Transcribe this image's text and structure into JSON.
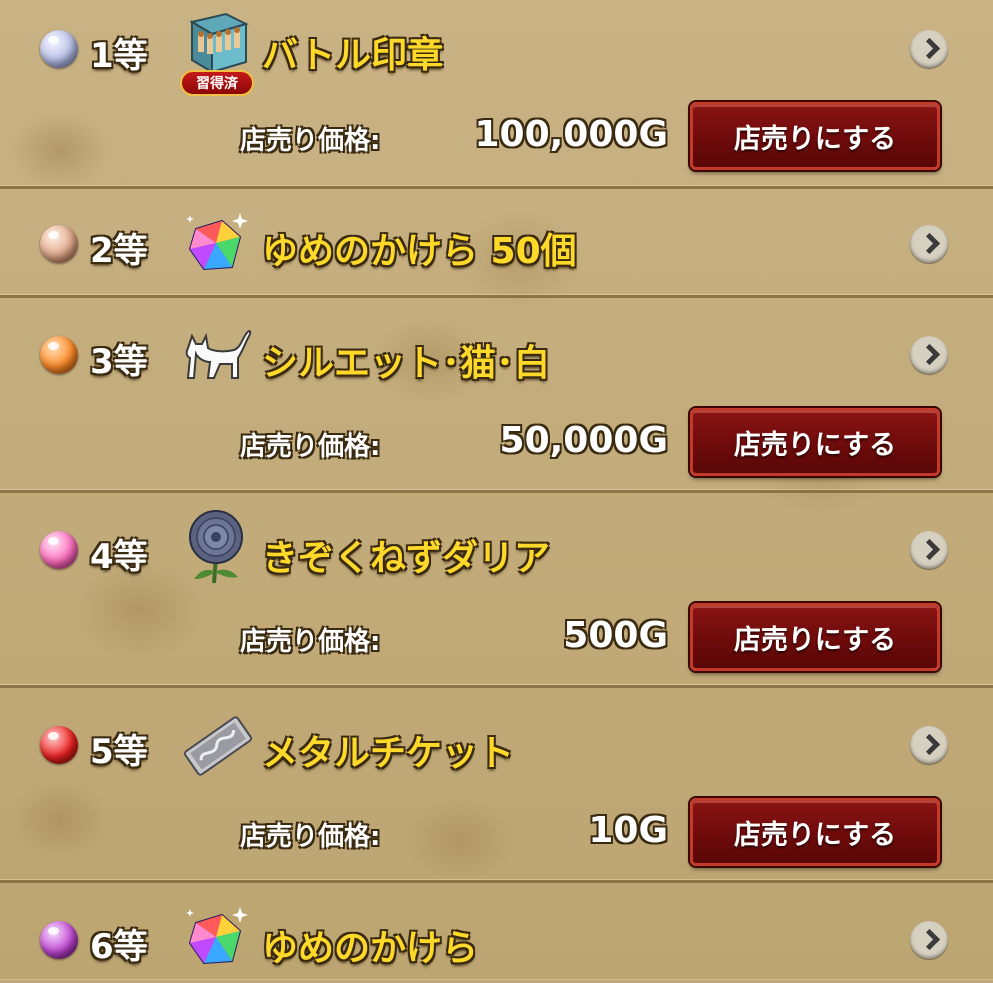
{
  "prizes": [
    {
      "rank": "1等",
      "orb_color": "#b9c0e8",
      "icon": "battle-seal-box-icon",
      "name": "バトル印章",
      "badge": "習得済",
      "sell_label": "店売り価格:",
      "price": "100,000G",
      "sell_button": "店売りにする"
    },
    {
      "rank": "2等",
      "orb_color": "#e2a98a",
      "icon": "dream-shard-icon",
      "name": "ゆめのかけら  50個"
    },
    {
      "rank": "3等",
      "orb_color": "#ff8c2a",
      "icon": "white-cat-silhouette-icon",
      "name": "シルエット･猫･白",
      "sell_label": "店売り価格:",
      "price": "50,000G",
      "sell_button": "店売りにする"
    },
    {
      "rank": "4等",
      "orb_color": "#ff6fc0",
      "icon": "dahlia-flower-icon",
      "name": "きぞくねずダリア",
      "sell_label": "店売り価格:",
      "price": "500G",
      "sell_button": "店売りにする"
    },
    {
      "rank": "5等",
      "orb_color": "#ee2222",
      "icon": "metal-ticket-icon",
      "name": "メタルチケット",
      "sell_label": "店売り価格:",
      "price": "10G",
      "sell_button": "店売りにする"
    },
    {
      "rank": "6等",
      "orb_color": "#c24ad4",
      "icon": "dream-shard-icon",
      "name": "ゆめのかけら"
    }
  ]
}
